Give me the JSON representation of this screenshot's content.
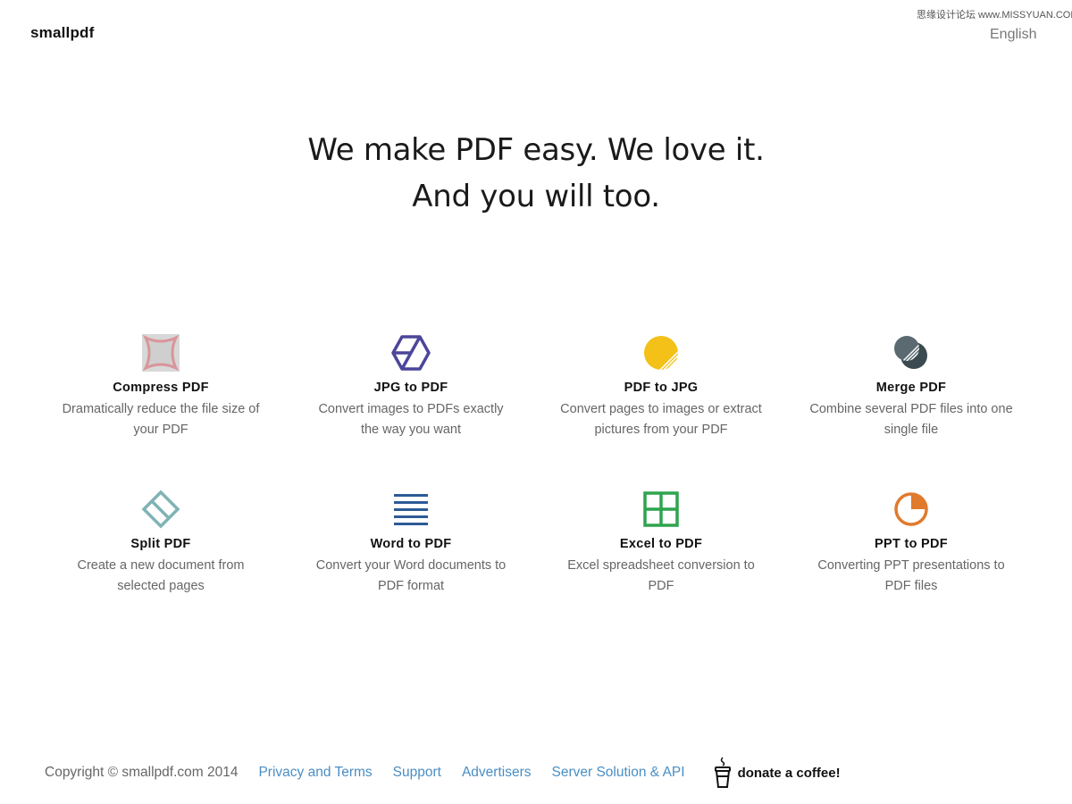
{
  "header": {
    "logo": "smallpdf",
    "language": "English",
    "watermark": "思缘设计论坛 www.MISSYUAN.COM"
  },
  "hero": {
    "line1": "We make PDF easy. We love it.",
    "line2": "And you will too."
  },
  "tools": [
    {
      "title": "Compress PDF",
      "desc": "Dramatically reduce the file size of your PDF",
      "icon": "compress-icon",
      "color": "#d9959a"
    },
    {
      "title": "JPG to PDF",
      "desc": "Convert images to PDFs exactly the way you want",
      "icon": "jpg-cube-icon",
      "color": "#4b469a"
    },
    {
      "title": "PDF to JPG",
      "desc": "Convert pages to images or extract pictures from your PDF",
      "icon": "sun-icon",
      "color": "#f3c118"
    },
    {
      "title": "Merge PDF",
      "desc": "Combine several PDF files into one single file",
      "icon": "merge-circles-icon",
      "color": "#3a4a50"
    },
    {
      "title": "Split PDF",
      "desc": "Create a new document from selected pages",
      "icon": "split-diamond-icon",
      "color": "#7fb3b5"
    },
    {
      "title": "Word to PDF",
      "desc": "Convert your Word documents to PDF format",
      "icon": "word-lines-icon",
      "color": "#2d5a96"
    },
    {
      "title": "Excel to PDF",
      "desc": "Excel spreadsheet conversion to PDF",
      "icon": "excel-grid-icon",
      "color": "#2ea44f"
    },
    {
      "title": "PPT to PDF",
      "desc": "Converting PPT presentations to PDF files",
      "icon": "pie-chart-icon",
      "color": "#e07a2c"
    }
  ],
  "footer": {
    "copyright": "Copyright © smallpdf.com 2014",
    "links": [
      "Privacy and Terms",
      "Support",
      "Advertisers",
      "Server Solution & API"
    ],
    "donate": "donate a coffee!"
  }
}
